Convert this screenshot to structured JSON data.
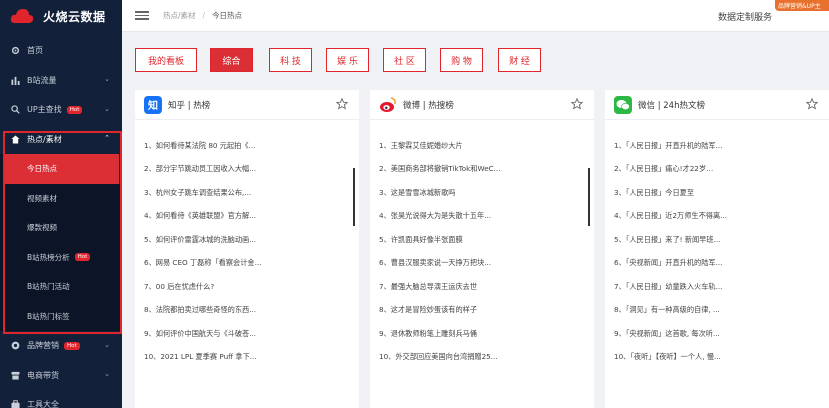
{
  "app": {
    "logo_text": "火烧云数据",
    "corner_badge": "品牌营销&UP主"
  },
  "sidebar": {
    "items": [
      {
        "label": "首页"
      },
      {
        "label": "B站流量"
      },
      {
        "label": "UP主查找",
        "badge": "Hot"
      },
      {
        "label": "热点/素材"
      },
      {
        "label": "品牌营销",
        "badge": "Hot"
      },
      {
        "label": "电商带货"
      },
      {
        "label": "工具大全"
      }
    ],
    "submenu": [
      {
        "label": "今日热点"
      },
      {
        "label": "视频素材"
      },
      {
        "label": "爆款视频"
      },
      {
        "label": "B站热榜分析",
        "badge": "Hot"
      },
      {
        "label": "B站热门活动"
      },
      {
        "label": "B站热门标签"
      }
    ]
  },
  "header": {
    "breadcrumb_parent": "热点/素材",
    "breadcrumb_sep": "/",
    "breadcrumb_current": "今日热点",
    "right_link": "数据定制服务"
  },
  "categories": [
    "我的看板",
    "综合",
    "科 技",
    "娱 乐",
    "社 区",
    "购 物",
    "财 经"
  ],
  "cards": [
    {
      "title": "知乎 | 热榜",
      "logo_glyph": "知",
      "logo_color": "#1772f6",
      "rows": [
        "1、如何看待某法院 80 元起拍《...",
        "2、部分宇节跳动员工因收入大幅...",
        "3、杭州女子跳车调查结果公布,...",
        "4、如何看待《英雄联盟》官方解...",
        "5、如何评价雷霆冰城的洗脑动画...",
        "6、网易 CEO 丁磊称「看察会计金...",
        "7、00 后在忧虑什么?",
        "8、法院都拍卖过哪些奇怪的东西...",
        "9、如何评价中国航天与《斗破苍...",
        "10、2021 LPL 夏季赛 Puff 拿下..."
      ]
    },
    {
      "title": "微博 | 热搜榜",
      "logo_glyph": "微",
      "logo_color": "#f5a623",
      "rows": [
        "1、王黎霖艾佳妮婚纱大片",
        "2、美国商务部将撤销TikTok和WeC...",
        "3、这是雪雪冰城新歌吗",
        "4、张昊光说得大为是失散十五年...",
        "5、许凯面具好像半张面膜",
        "6、曹县汉服卖家说一天挣万把块...",
        "7、最强大脑总导演王运庆去世",
        "8、这才是冒险妙蛋该有的样子",
        "9、退休教师粉笔上雕刻兵马俑",
        "10、外交部回应美国向台湾捐赠25..."
      ]
    },
    {
      "title": "微信 | 24h热文榜",
      "logo_glyph": "信",
      "logo_color": "#2db846",
      "rows": [
        "1、「人民日报」开直升机的陆军...",
        "2、「人民日报」痛心!才22岁…",
        "3、「人民日报」今日夏至",
        "4、「人民日报」近2万师生不得离...",
        "5、「人民日报」来了! 新闻早班...",
        "6、「央视新闻」开直升机的陆军...",
        "7、「人民日报」幼童跌入火车轨...",
        "8、「洞见」有一种高级的自律, ...",
        "9、「央视新闻」这首歌, 每次听...",
        "10、「夜听」【夜听】一个人, 慢..."
      ]
    }
  ]
}
